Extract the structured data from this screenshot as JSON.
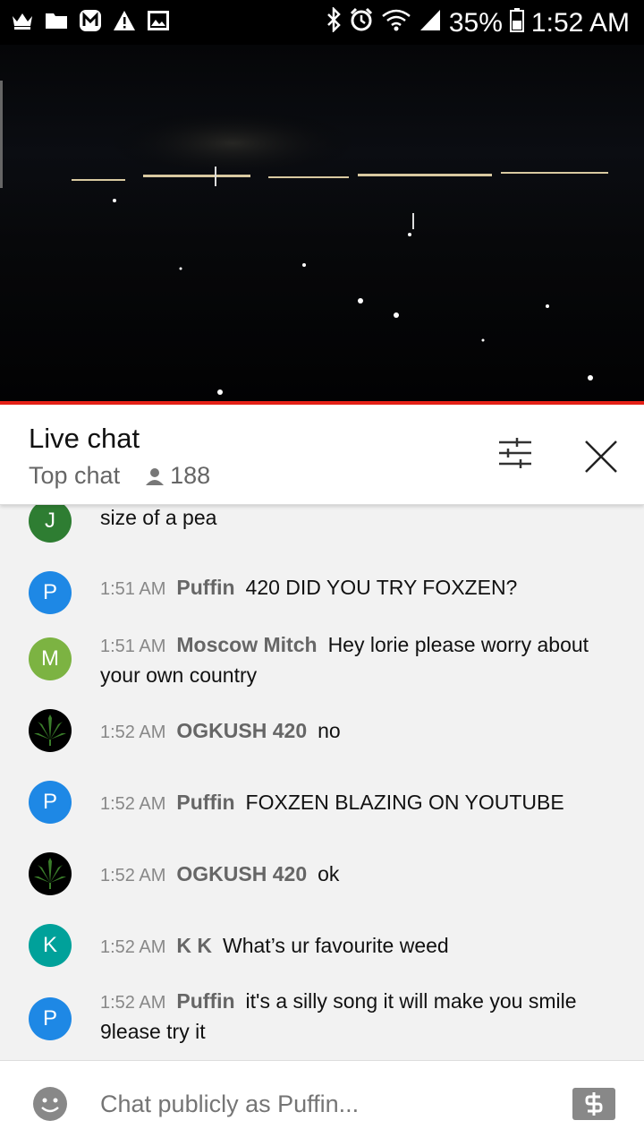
{
  "status_bar": {
    "battery": "35%",
    "time": "1:52 AM"
  },
  "chat_header": {
    "title": "Live chat",
    "mode": "Top chat",
    "viewer_count": "188"
  },
  "messages": [
    {
      "author": "",
      "time": "",
      "text": "size of a pea",
      "avatar_letter": "J",
      "avatar_color": "#2e7d32"
    },
    {
      "author": "Puffin",
      "time": "1:51 AM",
      "text": "420 DID YOU TRY FOXZEN?",
      "avatar_letter": "P",
      "avatar_color": "#1e88e5"
    },
    {
      "author": "Moscow Mitch",
      "time": "1:51 AM",
      "text": "Hey lorie please worry about your own country",
      "avatar_letter": "M",
      "avatar_color": "#7cb342"
    },
    {
      "author": "OGKUSH 420",
      "time": "1:52 AM",
      "text": "no",
      "avatar_letter": "",
      "avatar_color": "#000000"
    },
    {
      "author": "Puffin",
      "time": "1:52 AM",
      "text": "FOXZEN BLAZING ON YOUTUBE",
      "avatar_letter": "P",
      "avatar_color": "#1e88e5"
    },
    {
      "author": "OGKUSH 420",
      "time": "1:52 AM",
      "text": "ok",
      "avatar_letter": "",
      "avatar_color": "#000000"
    },
    {
      "author": "K K",
      "time": "1:52 AM",
      "text": "What’s ur favourite weed",
      "avatar_letter": "K",
      "avatar_color": "#00a19a"
    },
    {
      "author": "Puffin",
      "time": "1:52 AM",
      "text": "it's a silly song it will make you smile 9lease try it",
      "avatar_letter": "P",
      "avatar_color": "#1e88e5"
    }
  ],
  "input": {
    "placeholder": "Chat publicly as Puffin..."
  },
  "colors": {
    "accent": "#e62117",
    "chat_bg": "#f2f2f2"
  }
}
